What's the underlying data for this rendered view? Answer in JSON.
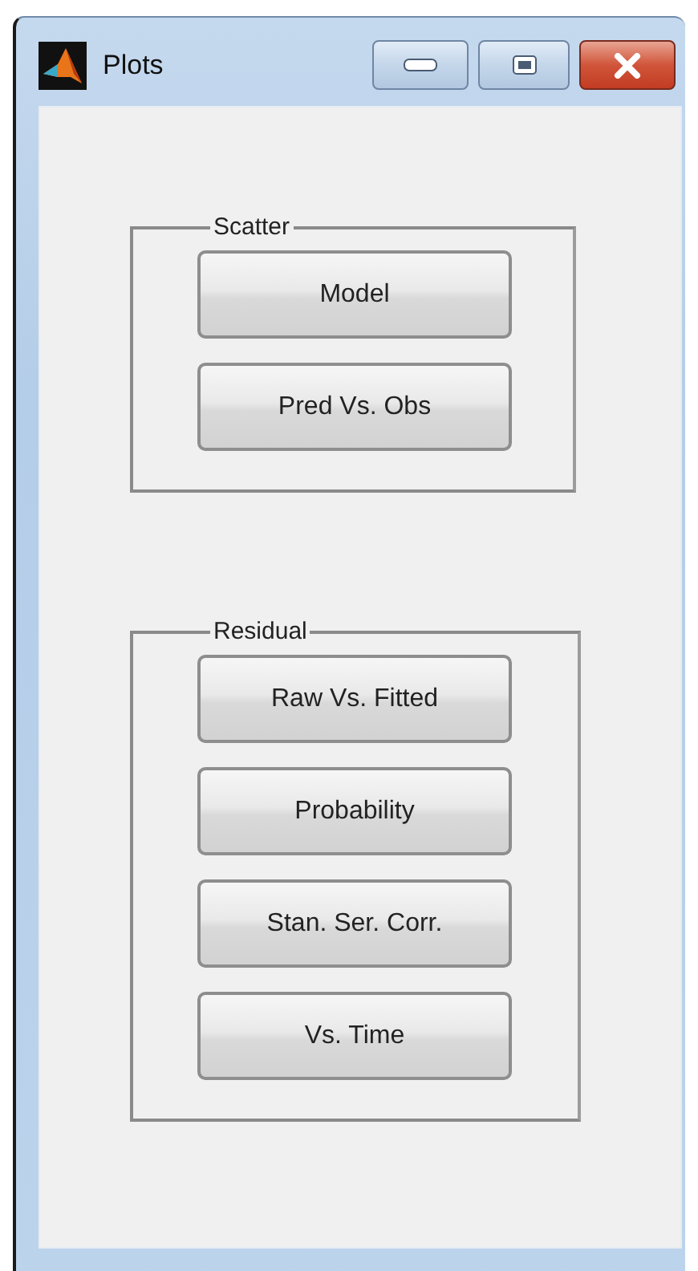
{
  "window": {
    "title": "Plots"
  },
  "groups": [
    {
      "label": "Scatter",
      "buttons": [
        "Model",
        "Pred Vs. Obs"
      ]
    },
    {
      "label": "Residual",
      "buttons": [
        "Raw Vs. Fitted",
        "Probability",
        "Stan. Ser. Corr.",
        "Vs. Time"
      ]
    }
  ]
}
